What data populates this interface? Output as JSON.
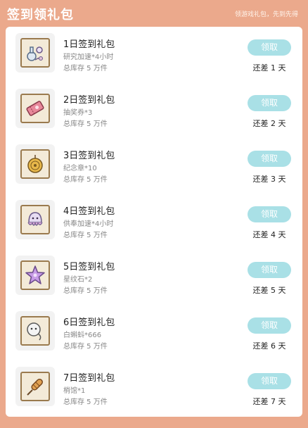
{
  "header": {
    "title": "签到领礼包",
    "hint": "领游戏礼包，先到先得"
  },
  "gifts": [
    {
      "name": "1日签到礼包",
      "reward": "研究加速*4小时",
      "stock": "总库存 5 万件",
      "claim_label": "领取",
      "remaining": "还差 1 天",
      "icon": "potion-flask-icon"
    },
    {
      "name": "2日签到礼包",
      "reward": "抽奖券*3",
      "stock": "总库存 5 万件",
      "claim_label": "领取",
      "remaining": "还差 2 天",
      "icon": "ticket-icon"
    },
    {
      "name": "3日签到礼包",
      "reward": "纪念章*10",
      "stock": "总库存 5 万件",
      "claim_label": "领取",
      "remaining": "还差 3 天",
      "icon": "medal-icon"
    },
    {
      "name": "4日签到礼包",
      "reward": "供奉加速*4小时",
      "stock": "总库存 5 万件",
      "claim_label": "领取",
      "remaining": "还差 4 天",
      "icon": "ghost-jellyfish-icon"
    },
    {
      "name": "5日签到礼包",
      "reward": "星纹石*2",
      "stock": "总库存 5 万件",
      "claim_label": "领取",
      "remaining": "还差 5 天",
      "icon": "star-stone-icon"
    },
    {
      "name": "6日签到礼包",
      "reward": "白蝌蚪*666",
      "stock": "总库存 5 万件",
      "claim_label": "领取",
      "remaining": "还差 6 天",
      "icon": "tadpole-icon"
    },
    {
      "name": "7日签到礼包",
      "reward": "梢馆*1",
      "stock": "总库存 5 万件",
      "claim_label": "领取",
      "remaining": "还差 7 天",
      "icon": "skewer-icon"
    }
  ],
  "colors": {
    "page_background": "#eba98c",
    "claim_button": "#a9e0e6",
    "item_frame": "#9a7a4e"
  }
}
